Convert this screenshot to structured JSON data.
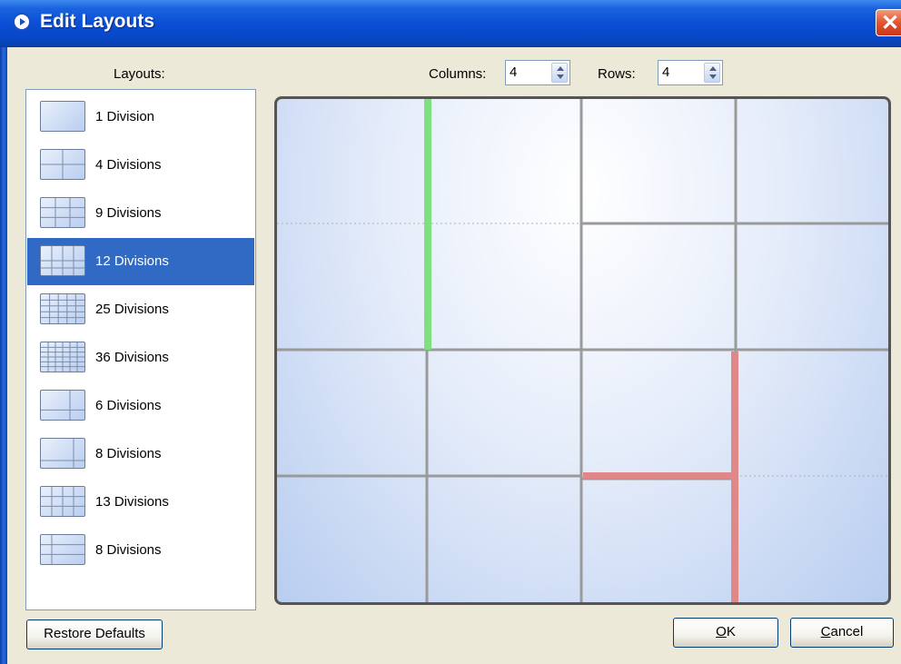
{
  "window": {
    "title": "Edit Layouts",
    "close_label": "✕"
  },
  "layouts_label": "Layouts:",
  "columns": {
    "label": "Columns:",
    "value": "4"
  },
  "rows": {
    "label": "Rows:",
    "value": "4"
  },
  "layouts": [
    {
      "label": "1 Division",
      "selected": false
    },
    {
      "label": "4 Divisions",
      "selected": false
    },
    {
      "label": "9 Divisions",
      "selected": false
    },
    {
      "label": "12 Divisions",
      "selected": true
    },
    {
      "label": "25 Divisions",
      "selected": false
    },
    {
      "label": "36 Divisions",
      "selected": false
    },
    {
      "label": "6 Divisions",
      "selected": false
    },
    {
      "label": "8 Divisions",
      "selected": false
    },
    {
      "label": "13 Divisions",
      "selected": false
    },
    {
      "label": "8 Divisions",
      "selected": false
    }
  ],
  "buttons": {
    "restore": "Restore Defaults",
    "ok_underlined": "O",
    "ok_rest": "K",
    "cancel_underlined": "C",
    "cancel_rest": "ancel"
  },
  "colors": {
    "selection": "#316ac5",
    "highlight_green": "#7ee07e",
    "highlight_red": "#e08888",
    "grid_line": "#9a9a9a"
  }
}
